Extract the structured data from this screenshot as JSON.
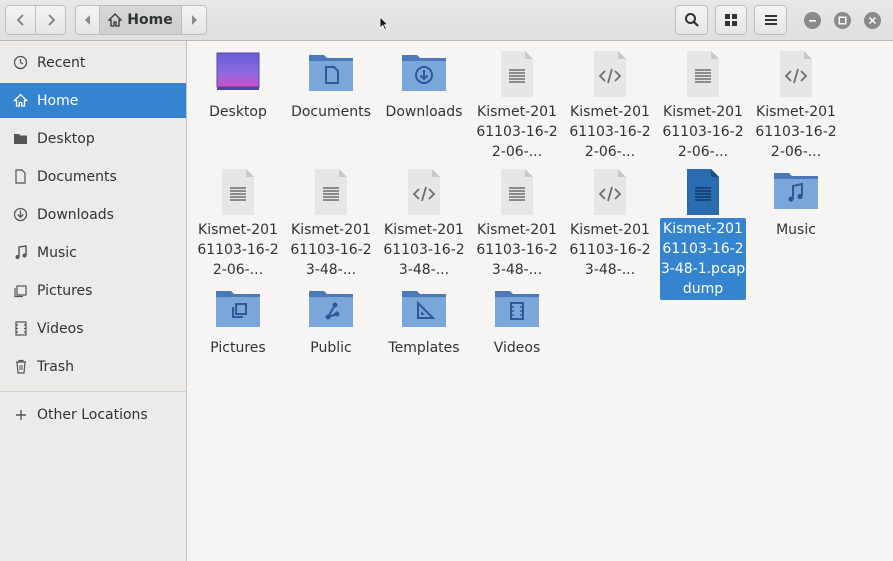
{
  "header": {
    "path_label": "Home"
  },
  "sidebar": {
    "items": [
      {
        "label": "Recent",
        "icon": "clock-icon"
      },
      {
        "label": "Home",
        "icon": "home-icon",
        "active": true
      },
      {
        "label": "Desktop",
        "icon": "folder-icon"
      },
      {
        "label": "Documents",
        "icon": "document-icon"
      },
      {
        "label": "Downloads",
        "icon": "download-icon"
      },
      {
        "label": "Music",
        "icon": "music-icon"
      },
      {
        "label": "Pictures",
        "icon": "picture-icon"
      },
      {
        "label": "Videos",
        "icon": "video-icon"
      },
      {
        "label": "Trash",
        "icon": "trash-icon"
      }
    ],
    "other_locations": "Other Locations"
  },
  "files": [
    {
      "label": "Desktop",
      "kind": "desktop"
    },
    {
      "label": "Documents",
      "kind": "folder-documents"
    },
    {
      "label": "Downloads",
      "kind": "folder-downloads"
    },
    {
      "label": "Kismet-20161103-16-22-06-...",
      "kind": "text"
    },
    {
      "label": "Kismet-20161103-16-22-06-...",
      "kind": "xml"
    },
    {
      "label": "Kismet-20161103-16-22-06-...",
      "kind": "text"
    },
    {
      "label": "Kismet-20161103-16-22-06-...",
      "kind": "xml"
    },
    {
      "label": "Kismet-20161103-16-22-06-...",
      "kind": "text"
    },
    {
      "label": "Kismet-20161103-16-23-48-...",
      "kind": "text"
    },
    {
      "label": "Kismet-20161103-16-23-48-...",
      "kind": "xml"
    },
    {
      "label": "Kismet-20161103-16-23-48-...",
      "kind": "text"
    },
    {
      "label": "Kismet-20161103-16-23-48-...",
      "kind": "xml"
    },
    {
      "label": "Kismet-20161103-16-23-48-1.pcapdump",
      "kind": "binary",
      "selected": true
    },
    {
      "label": "Music",
      "kind": "folder-music"
    },
    {
      "label": "Pictures",
      "kind": "folder-pictures"
    },
    {
      "label": "Public",
      "kind": "folder-public"
    },
    {
      "label": "Templates",
      "kind": "folder-templates"
    },
    {
      "label": "Videos",
      "kind": "folder-videos"
    }
  ],
  "colors": {
    "accent": "#3584d0",
    "folder": "#6b9bd2",
    "file": "#e3e3e3"
  }
}
